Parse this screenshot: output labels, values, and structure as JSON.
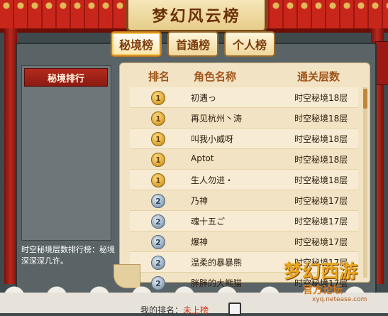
{
  "title": "梦幻风云榜",
  "tabs": [
    {
      "label": "秘境榜",
      "active": true
    },
    {
      "label": "首通榜",
      "active": false
    },
    {
      "label": "个人榜",
      "active": false
    }
  ],
  "sidebar": {
    "items": [
      {
        "label": "秘境排行"
      }
    ],
    "description": "时空秘境层数排行榜：秘境深深深几许。"
  },
  "table": {
    "headers": [
      "排名",
      "角色名称",
      "通关层数"
    ],
    "rows": [
      {
        "rank": "1",
        "medal": "gold",
        "name": "初遇っ",
        "floor": "时空秘境18层"
      },
      {
        "rank": "1",
        "medal": "gold",
        "name": "再见杭州丶涛",
        "floor": "时空秘境18层"
      },
      {
        "rank": "1",
        "medal": "gold",
        "name": "叫我小威呀",
        "floor": "时空秘境18层"
      },
      {
        "rank": "1",
        "medal": "gold",
        "name": "Aptot",
        "floor": "时空秘境18层"
      },
      {
        "rank": "1",
        "medal": "gold",
        "name": "生人勿进・",
        "floor": "时空秘境18层"
      },
      {
        "rank": "2",
        "medal": "silver",
        "name": "乃神",
        "floor": "时空秘境17层"
      },
      {
        "rank": "2",
        "medal": "silver",
        "name": "魂十五ご",
        "floor": "时空秘境17层"
      },
      {
        "rank": "2",
        "medal": "silver",
        "name": "爆神",
        "floor": "时空秘境17层"
      },
      {
        "rank": "2",
        "medal": "silver",
        "name": "温柔的暴暴熊",
        "floor": "时空秘境17层"
      },
      {
        "rank": "2",
        "medal": "silver",
        "name": "胖胖的大熊猫",
        "floor": "时空秘境17层"
      }
    ]
  },
  "my_rank": {
    "label": "我的排名：",
    "value": "未上榜"
  },
  "watermark": {
    "logo": "梦幻西游",
    "sub": "官方论坛",
    "url": "xyq.netease.com"
  }
}
